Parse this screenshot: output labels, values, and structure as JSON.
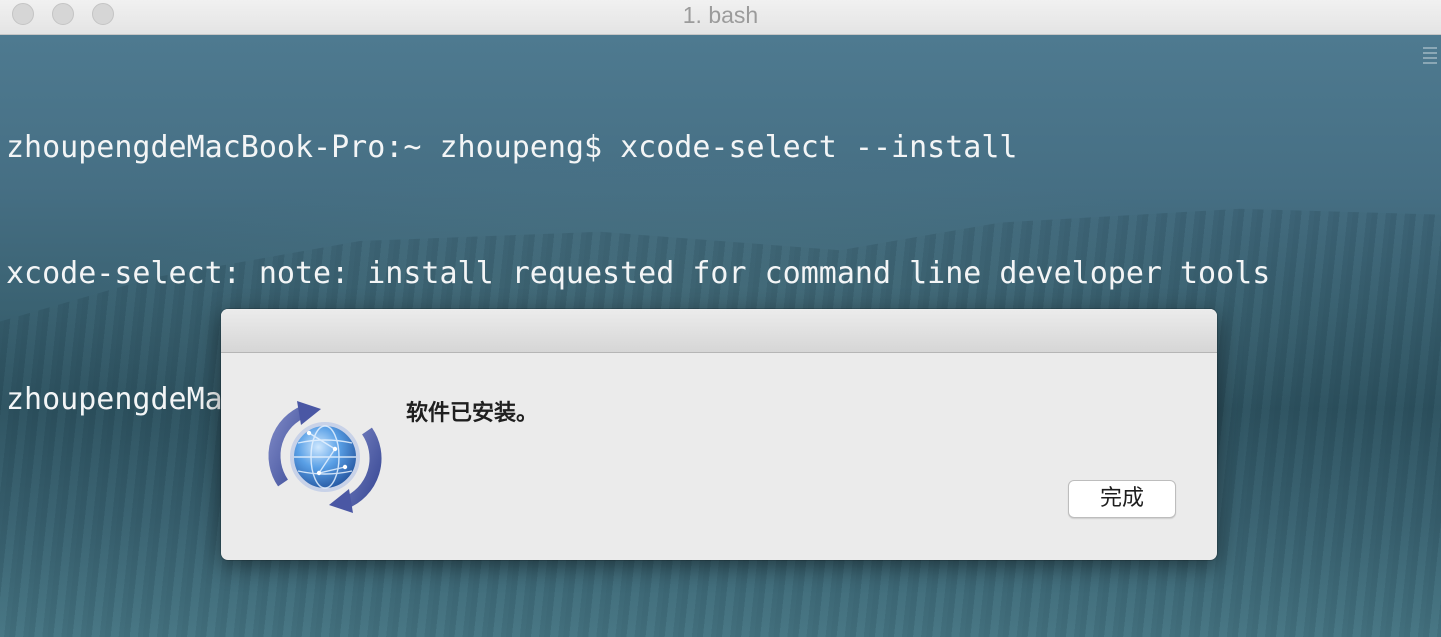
{
  "window": {
    "title": "1. bash"
  },
  "terminal": {
    "lines": [
      "zhoupengdeMacBook-Pro:~ zhoupeng$ xcode-select --install",
      "xcode-select: note: install requested for command line developer tools",
      "zhoupengdeMacBook-Pro:~ zhoupeng$ "
    ]
  },
  "dialog": {
    "message": "软件已安装。",
    "done_label": "完成",
    "icon": "software-update-globe-icon"
  }
}
